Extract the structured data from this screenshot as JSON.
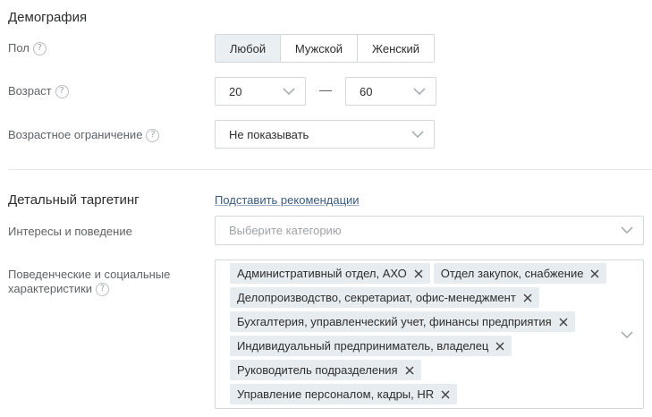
{
  "demography": {
    "title": "Демография",
    "gender": {
      "label": "Пол",
      "options": [
        "Любой",
        "Мужской",
        "Женский"
      ],
      "selected": "Любой"
    },
    "age": {
      "label": "Возраст",
      "from": "20",
      "to": "60",
      "separator": "—"
    },
    "age_restriction": {
      "label": "Возрастное ограничение",
      "value": "Не показывать"
    }
  },
  "detailed": {
    "title": "Детальный таргетинг",
    "recommend_link": "Подставить рекомендации",
    "interests": {
      "label": "Интересы и поведение",
      "placeholder": "Выберите категорию"
    },
    "behavior": {
      "label_line1": "Поведенческие и социальные",
      "label_line2": "характеристики",
      "tags": [
        "Административный отдел, АХО",
        "Отдел закупок, снабжение",
        "Делопроизводство, секретариат, офис-менеджмент",
        "Бухгалтерия, управленческий учет, финансы предприятия",
        "Индивидуальный предприниматель, владелец",
        "Руководитель подразделения",
        "Управление персоналом, кадры, HR"
      ]
    }
  },
  "help_glyph": "?",
  "icons": {
    "chevron": "chevron-down-icon",
    "remove": "close-icon",
    "help": "help-icon"
  },
  "colors": {
    "border": "#d3d6db",
    "tag_bg": "#e6ecf0",
    "active_seg": "#e9eff3",
    "link": "#3a5b80"
  }
}
